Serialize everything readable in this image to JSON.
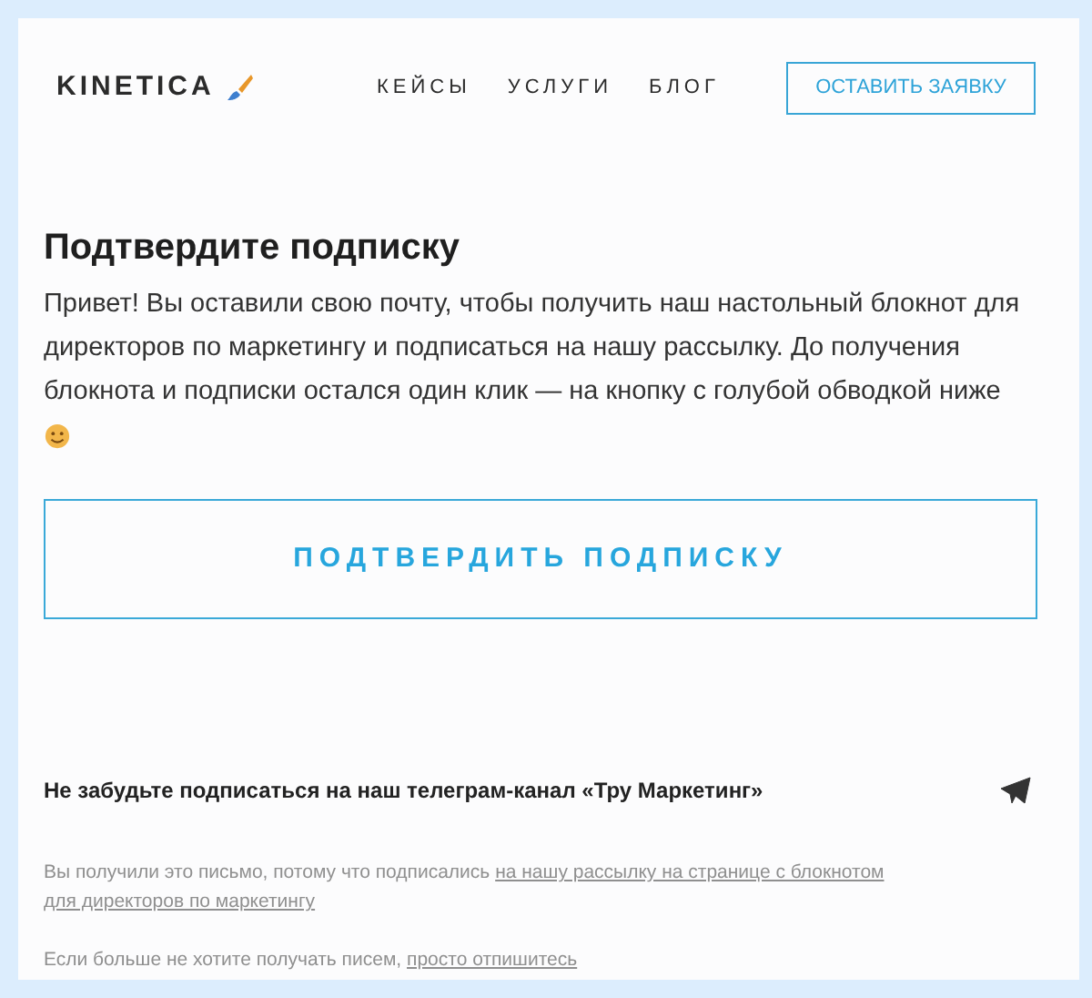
{
  "header": {
    "logo": "KINETICA",
    "nav": [
      "КЕЙСЫ",
      "УСЛУГИ",
      "БЛОГ"
    ],
    "cta": "ОСТАВИТЬ ЗАЯВКУ"
  },
  "title": "Подтвердите подписку",
  "body": "Привет! Вы оставили свою почту, чтобы получить наш настольный блокнот для директоров по маркетингу и подписаться на нашу рассылку. До получения блокнота и подписки остался один клик — на кнопку с голубой обводкой ниже",
  "confirm_button": "ПОДТВЕРДИТЬ ПОДПИСКУ",
  "telegram": "Не забудьте подписаться на наш телеграм-канал «Тру Маркетинг»",
  "footer": {
    "reason": "Вы получили это письмо, потому что подписались",
    "reason_link": [
      "на нашу рассылку на странице с блокнотом",
      "для директоров по маркетингу"
    ],
    "unsubscribe": "Если больше не хотите получать писем,",
    "unsubscribe_link": "просто отпишитесь"
  }
}
